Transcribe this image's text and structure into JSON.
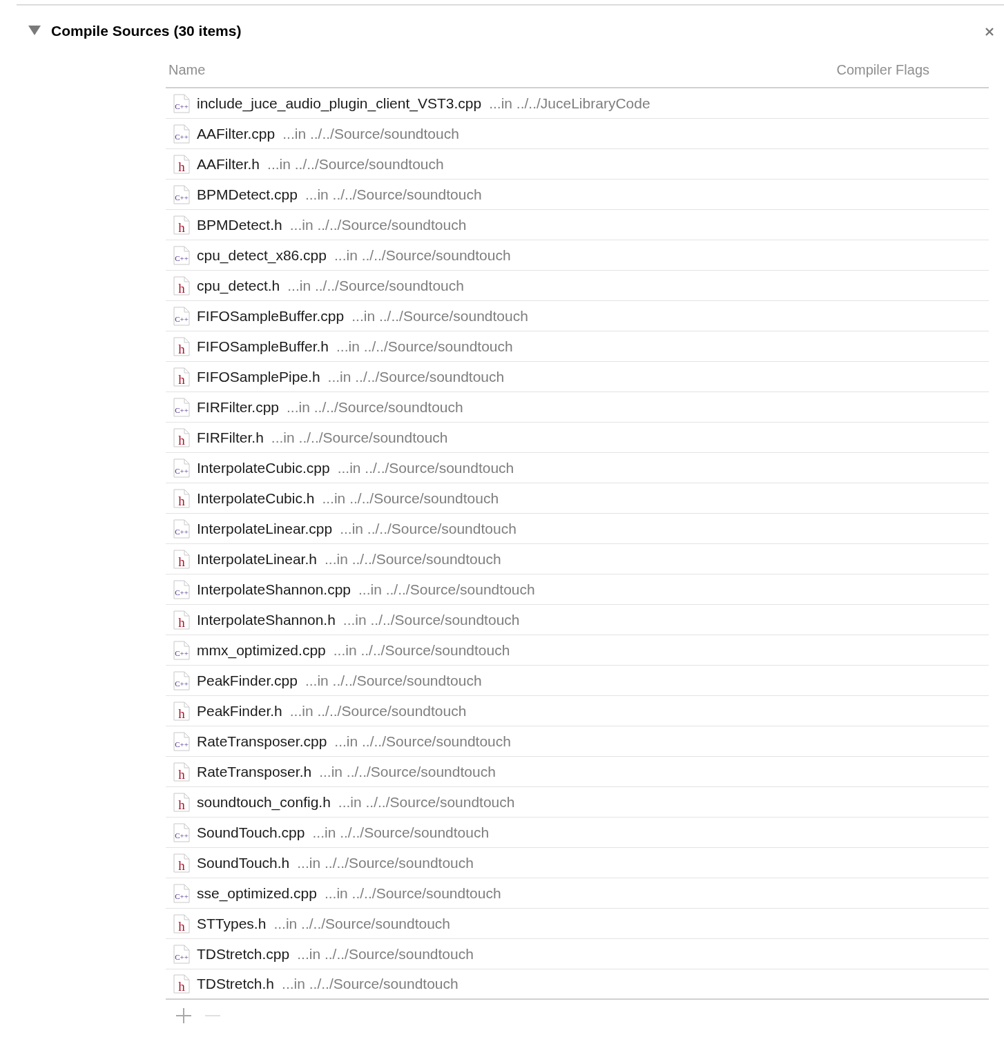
{
  "section": {
    "title": "Compile Sources (30 items)",
    "expanded": true
  },
  "table": {
    "columns": [
      "Name",
      "Compiler Flags"
    ],
    "rows": [
      {
        "kind": "cpp",
        "icon_text": "C++",
        "name": "include_juce_audio_plugin_client_VST3.cpp",
        "location": "...in ../../JuceLibraryCode"
      },
      {
        "kind": "cpp",
        "icon_text": "C++",
        "name": "AAFilter.cpp",
        "location": "...in ../../Source/soundtouch"
      },
      {
        "kind": "h",
        "icon_text": "h",
        "name": "AAFilter.h",
        "location": "...in ../../Source/soundtouch"
      },
      {
        "kind": "cpp",
        "icon_text": "C++",
        "name": "BPMDetect.cpp",
        "location": "...in ../../Source/soundtouch"
      },
      {
        "kind": "h",
        "icon_text": "h",
        "name": "BPMDetect.h",
        "location": "...in ../../Source/soundtouch"
      },
      {
        "kind": "cpp",
        "icon_text": "C++",
        "name": "cpu_detect_x86.cpp",
        "location": "...in ../../Source/soundtouch"
      },
      {
        "kind": "h",
        "icon_text": "h",
        "name": "cpu_detect.h",
        "location": "...in ../../Source/soundtouch"
      },
      {
        "kind": "cpp",
        "icon_text": "C++",
        "name": "FIFOSampleBuffer.cpp",
        "location": "...in ../../Source/soundtouch"
      },
      {
        "kind": "h",
        "icon_text": "h",
        "name": "FIFOSampleBuffer.h",
        "location": "...in ../../Source/soundtouch"
      },
      {
        "kind": "h",
        "icon_text": "h",
        "name": "FIFOSamplePipe.h",
        "location": "...in ../../Source/soundtouch"
      },
      {
        "kind": "cpp",
        "icon_text": "C++",
        "name": "FIRFilter.cpp",
        "location": "...in ../../Source/soundtouch"
      },
      {
        "kind": "h",
        "icon_text": "h",
        "name": "FIRFilter.h",
        "location": "...in ../../Source/soundtouch"
      },
      {
        "kind": "cpp",
        "icon_text": "C++",
        "name": "InterpolateCubic.cpp",
        "location": "...in ../../Source/soundtouch"
      },
      {
        "kind": "h",
        "icon_text": "h",
        "name": "InterpolateCubic.h",
        "location": "...in ../../Source/soundtouch"
      },
      {
        "kind": "cpp",
        "icon_text": "C++",
        "name": "InterpolateLinear.cpp",
        "location": "...in ../../Source/soundtouch"
      },
      {
        "kind": "h",
        "icon_text": "h",
        "name": "InterpolateLinear.h",
        "location": "...in ../../Source/soundtouch"
      },
      {
        "kind": "cpp",
        "icon_text": "C++",
        "name": "InterpolateShannon.cpp",
        "location": "...in ../../Source/soundtouch"
      },
      {
        "kind": "h",
        "icon_text": "h",
        "name": "InterpolateShannon.h",
        "location": "...in ../../Source/soundtouch"
      },
      {
        "kind": "cpp",
        "icon_text": "C++",
        "name": "mmx_optimized.cpp",
        "location": "...in ../../Source/soundtouch"
      },
      {
        "kind": "cpp",
        "icon_text": "C++",
        "name": "PeakFinder.cpp",
        "location": "...in ../../Source/soundtouch"
      },
      {
        "kind": "h",
        "icon_text": "h",
        "name": "PeakFinder.h",
        "location": "...in ../../Source/soundtouch"
      },
      {
        "kind": "cpp",
        "icon_text": "C++",
        "name": "RateTransposer.cpp",
        "location": "...in ../../Source/soundtouch"
      },
      {
        "kind": "h",
        "icon_text": "h",
        "name": "RateTransposer.h",
        "location": "...in ../../Source/soundtouch"
      },
      {
        "kind": "h",
        "icon_text": "h",
        "name": "soundtouch_config.h",
        "location": "...in ../../Source/soundtouch"
      },
      {
        "kind": "cpp",
        "icon_text": "C++",
        "name": "SoundTouch.cpp",
        "location": "...in ../../Source/soundtouch"
      },
      {
        "kind": "h",
        "icon_text": "h",
        "name": "SoundTouch.h",
        "location": "...in ../../Source/soundtouch"
      },
      {
        "kind": "cpp",
        "icon_text": "C++",
        "name": "sse_optimized.cpp",
        "location": "...in ../../Source/soundtouch"
      },
      {
        "kind": "h",
        "icon_text": "h",
        "name": "STTypes.h",
        "location": "...in ../../Source/soundtouch"
      },
      {
        "kind": "cpp",
        "icon_text": "C++",
        "name": "TDStretch.cpp",
        "location": "...in ../../Source/soundtouch"
      },
      {
        "kind": "h",
        "icon_text": "h",
        "name": "TDStretch.h",
        "location": "...in ../../Source/soundtouch"
      }
    ]
  },
  "footer": {
    "add_disabled": false,
    "remove_disabled": true
  }
}
